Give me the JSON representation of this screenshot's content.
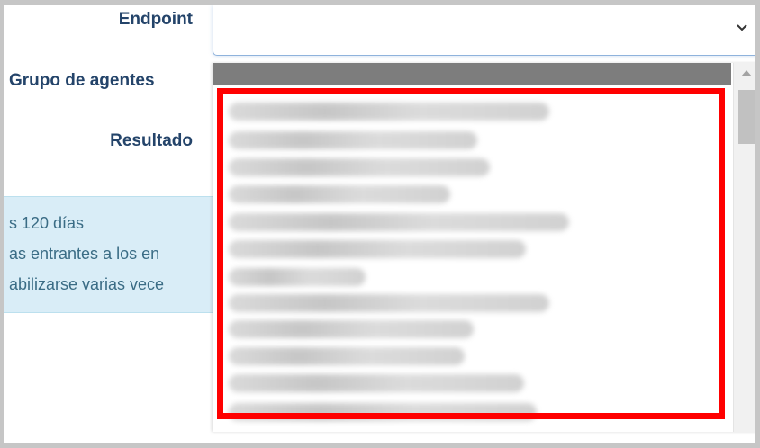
{
  "form": {
    "endpoint_label": "Endpoint",
    "agent_group_label": "Grupo de agentes",
    "result_label": "Resultado"
  },
  "endpoint_select": {
    "value": "",
    "icon": "chevron-down-icon"
  },
  "info_panel": {
    "lines": [
      "s 120 días",
      "as entrantes a los en",
      "abilizarse varias vece"
    ]
  },
  "agent_group_dropdown": {
    "options_blurred": true,
    "option_count_visible": 12,
    "scroll_icon": "scroll-up-arrow-icon"
  },
  "colors": {
    "label": "#24446a",
    "info_background": "#d9edf7",
    "info_text": "#3a6c85",
    "dropdown_header": "#7d7d7d",
    "highlight": "#ff0000",
    "select_border": "#8fb3dc"
  }
}
